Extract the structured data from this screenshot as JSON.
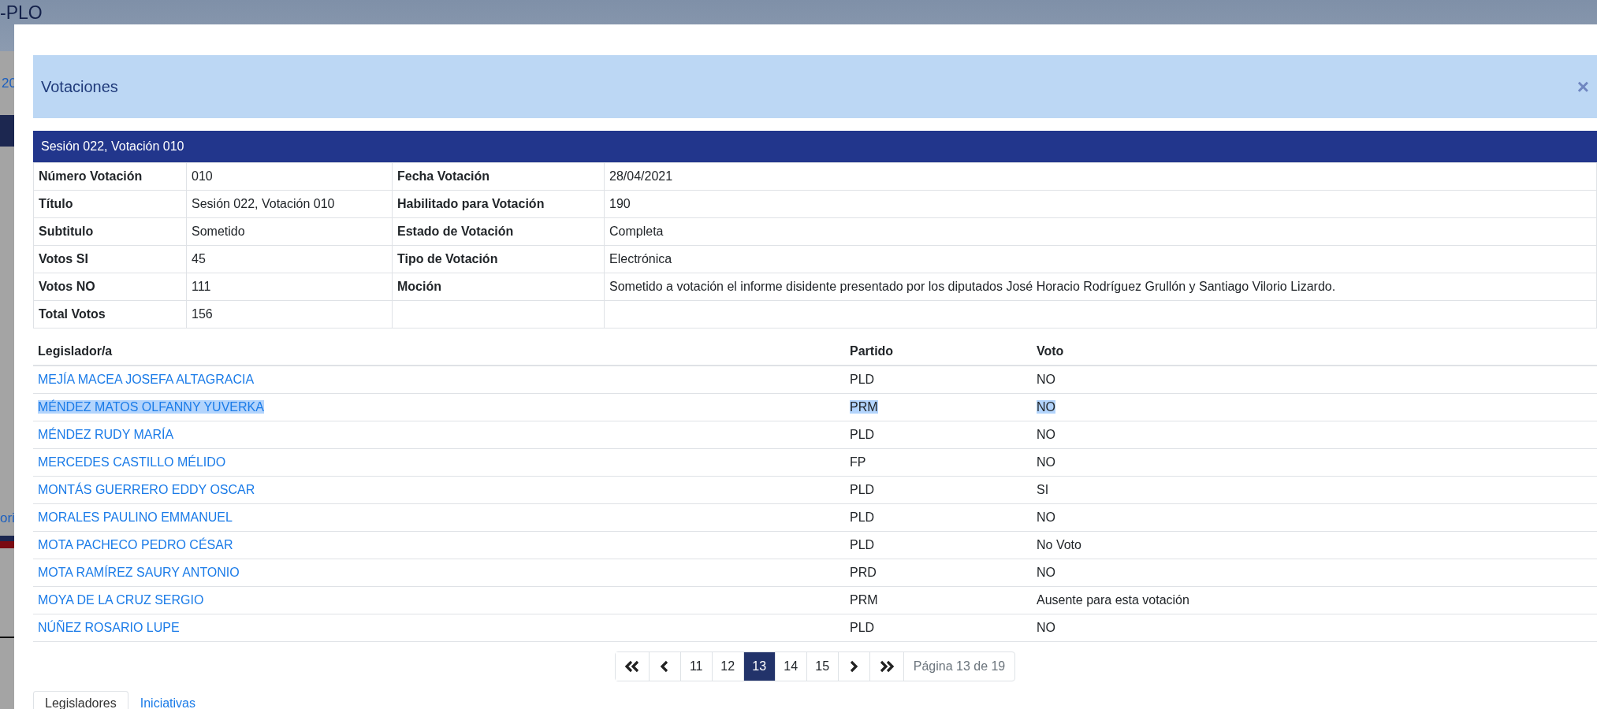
{
  "background": {
    "brand": "-PLO",
    "link": "20",
    "text": "ori"
  },
  "modal": {
    "title": "Votaciones",
    "close": "×"
  },
  "session_title": "Sesión 022, Votación 010",
  "details": [
    [
      {
        "label": "Número Votación",
        "value": "010"
      },
      {
        "label": "Fecha Votación",
        "value": "28/04/2021"
      }
    ],
    [
      {
        "label": "Título",
        "value": "Sesión 022, Votación 010"
      },
      {
        "label": "Habilitado para Votación",
        "value": "190"
      }
    ],
    [
      {
        "label": "Subtitulo",
        "value": "Sometido"
      },
      {
        "label": "Estado de Votación",
        "value": "Completa"
      }
    ],
    [
      {
        "label": "Votos SI",
        "value": "45"
      },
      {
        "label": "Tipo de Votación",
        "value": "Electrónica"
      }
    ],
    [
      {
        "label": "Votos NO",
        "value": "111"
      },
      {
        "label": "Moción",
        "value": "Sometido a votación el informe disidente presentado por los diputados José Horacio Rodríguez Grullón y Santiago Vilorio Lizardo."
      }
    ],
    [
      {
        "label": "Total Votos",
        "value": "156"
      }
    ]
  ],
  "legislators": {
    "columns": [
      "Legislador/a",
      "Partido",
      "Voto"
    ],
    "rows": [
      {
        "name": "MEJÍA MACEA JOSEFA ALTAGRACIA",
        "party": "PLD",
        "vote": "NO",
        "highlighted": false
      },
      {
        "name": "MÉNDEZ MATOS OLFANNY YUVERKA",
        "party": "PRM",
        "vote": "NO",
        "highlighted": true
      },
      {
        "name": "MÉNDEZ RUDY MARÍA",
        "party": "PLD",
        "vote": "NO",
        "highlighted": false
      },
      {
        "name": "MERCEDES CASTILLO MÉLIDO",
        "party": "FP",
        "vote": "NO",
        "highlighted": false
      },
      {
        "name": "MONTÁS GUERRERO EDDY OSCAR",
        "party": "PLD",
        "vote": "SI",
        "highlighted": false
      },
      {
        "name": "MORALES PAULINO EMMANUEL",
        "party": "PLD",
        "vote": "NO",
        "highlighted": false
      },
      {
        "name": "MOTA PACHECO PEDRO CÉSAR",
        "party": "PLD",
        "vote": "No Voto",
        "highlighted": false
      },
      {
        "name": "MOTA RAMÍREZ SAURY ANTONIO",
        "party": "PRD",
        "vote": "NO",
        "highlighted": false
      },
      {
        "name": "MOYA DE LA CRUZ SERGIO",
        "party": "PRM",
        "vote": "Ausente para esta votación",
        "highlighted": false
      },
      {
        "name": "NÚÑEZ ROSARIO LUPE",
        "party": "PLD",
        "vote": "NO",
        "highlighted": false
      }
    ]
  },
  "pagination": {
    "pages": [
      {
        "label": "11",
        "selected": false
      },
      {
        "label": "12",
        "selected": false
      },
      {
        "label": "13",
        "selected": true
      },
      {
        "label": "14",
        "selected": false
      },
      {
        "label": "15",
        "selected": false
      }
    ],
    "info": "Página 13 de 19"
  },
  "tabs": [
    {
      "label": "Legisladores",
      "selected": true
    },
    {
      "label": "Iniciativas",
      "selected": false
    }
  ]
}
